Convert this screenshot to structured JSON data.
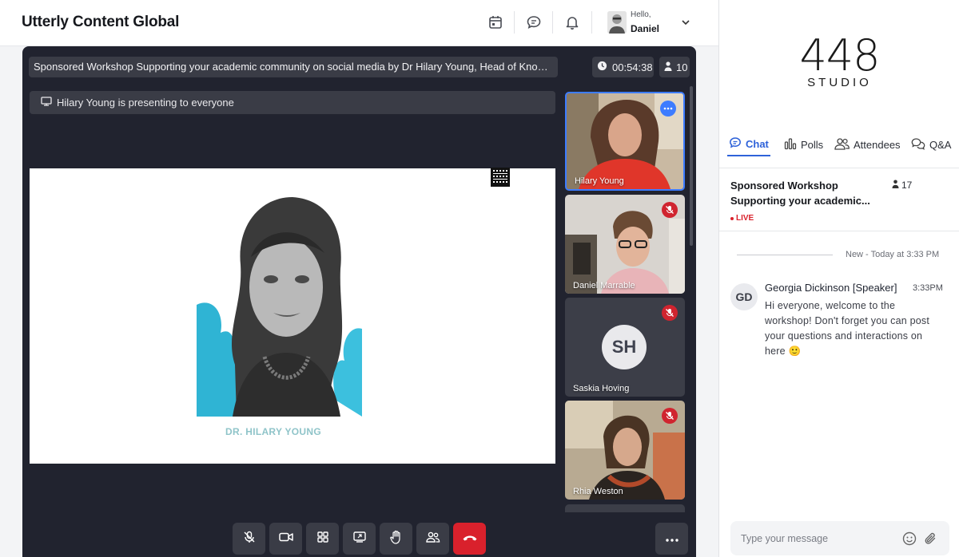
{
  "header": {
    "app_title": "Utterly Content Global",
    "greeting": "Hello,",
    "user_name": "Daniel",
    "icons": [
      "calendar-icon",
      "chat-bubble-icon",
      "bell-icon"
    ]
  },
  "stage": {
    "session_title": "Sponsored Workshop Supporting your academic community on social media by Dr Hilary Young, Head of Knowledge ...",
    "timer": "00:54:38",
    "participant_count": "10",
    "presenting_text": "Hilary Young is presenting to everyone",
    "slide_caption": "DR. HILARY YOUNG"
  },
  "participants": [
    {
      "name": "Hilary Young",
      "status": "more",
      "active": true
    },
    {
      "name": "Daniel Marrable",
      "status": "muted",
      "active": false
    },
    {
      "name": "Saskia Hoving",
      "initials": "SH",
      "status": "muted",
      "active": false
    },
    {
      "name": "Rhia Weston",
      "status": "muted",
      "active": false
    }
  ],
  "controls": [
    "mic-off-icon",
    "camera-icon",
    "grid-icon",
    "screen-share-icon",
    "raise-hand-icon",
    "participants-icon",
    "end-call-icon",
    "more-icon"
  ],
  "panel": {
    "logo_number": "448",
    "logo_text": "STUDIO",
    "tabs": [
      {
        "label": "Chat",
        "icon": "chat-icon"
      },
      {
        "label": "Polls",
        "icon": "polls-icon"
      },
      {
        "label": "Attendees",
        "icon": "attendees-icon"
      },
      {
        "label": "Q&A",
        "icon": "qa-icon"
      }
    ],
    "room_title": "Sponsored Workshop Supporting your academic...",
    "room_count": "17",
    "live_label": "LIVE",
    "new_divider": "New - Today at 3:33 PM",
    "message": {
      "initials": "GD",
      "author": "Georgia Dickinson [Speaker]",
      "time": "3:33PM",
      "text": "Hi everyone, welcome to the workshop! Don't forget you can post your questions and interactions on here 🙂"
    },
    "composer_placeholder": "Type your message"
  },
  "colors": {
    "stage_bg": "#21232f",
    "accent_blue": "#2e62d9",
    "end_call_red": "#d9212c",
    "live_red": "#d9212c"
  }
}
